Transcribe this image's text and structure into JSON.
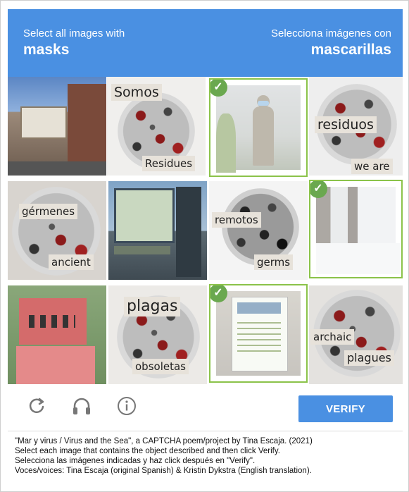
{
  "header": {
    "left_small": "Select all images with",
    "left_big": "masks",
    "right_small": "Selecciona imágenes con",
    "right_big": "mascarillas",
    "color": "#4a90e2"
  },
  "tiles": [
    {
      "labels": [],
      "selected": false,
      "scene": "theater-marquee"
    },
    {
      "labels": [
        "Somos",
        "Residues"
      ],
      "selected": false,
      "scene": "virus"
    },
    {
      "labels": [],
      "selected": true,
      "scene": "statue-with-mask"
    },
    {
      "labels": [
        "residuos",
        "we are"
      ],
      "selected": false,
      "scene": "virus"
    },
    {
      "labels": [
        "gérmenes",
        "ancient"
      ],
      "selected": false,
      "scene": "virus"
    },
    {
      "labels": [],
      "selected": false,
      "scene": "storefront"
    },
    {
      "labels": [
        "remotos",
        "germs"
      ],
      "selected": false,
      "scene": "virus-bw"
    },
    {
      "labels": [],
      "selected": true,
      "scene": "snowy-trees"
    },
    {
      "labels": [],
      "selected": false,
      "scene": "mask-sign"
    },
    {
      "labels": [
        "plagas",
        "obsoletas"
      ],
      "selected": false,
      "scene": "virus"
    },
    {
      "labels": [],
      "selected": true,
      "scene": "door-notice"
    },
    {
      "labels": [
        "archaic",
        "plagues"
      ],
      "selected": false,
      "scene": "virus"
    }
  ],
  "selected_color": "#8bc34a",
  "controls": {
    "reload_icon": "reload-icon",
    "audio_icon": "headphones-icon",
    "info_icon": "info-icon",
    "verify_label": "VERIFY"
  },
  "caption": {
    "line1": "\"Mar y virus / Virus and the Sea\", a CAPTCHA poem/project by Tina Escaja. (2021)",
    "line2": "Select each image that contains the object described and then click Verify.",
    "line3": "Selecciona las imágenes indicadas y haz click después en \"Verify\".",
    "line4": "Voces/voices: Tina Escaja (original Spanish) & Kristin Dykstra (English translation)."
  }
}
